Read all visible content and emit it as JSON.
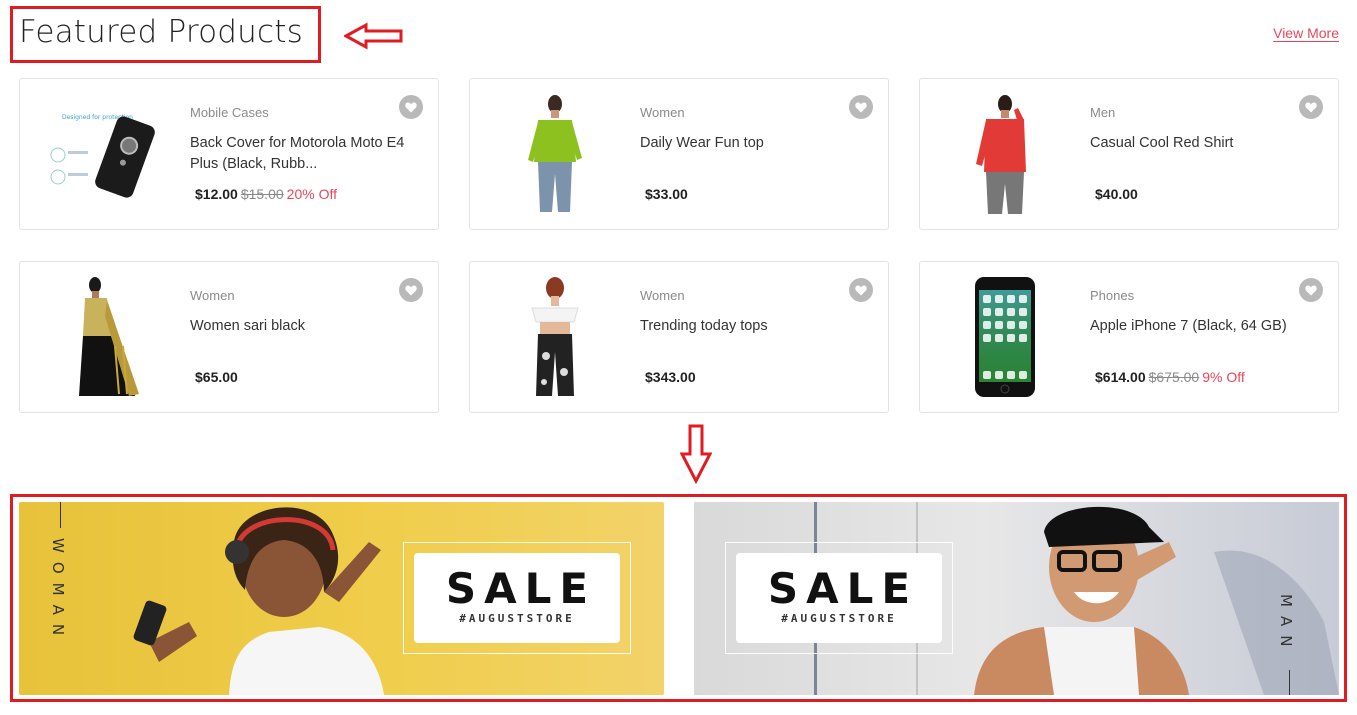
{
  "header": {
    "title": "Featured Products",
    "view_more": "View More"
  },
  "products": [
    {
      "category": "Mobile Cases",
      "name": "Back Cover for Motorola Moto E4 Plus (Black, Rubb...",
      "price": "$12.00",
      "old_price": "$15.00",
      "discount": "20% Off",
      "image": "phone-case-image"
    },
    {
      "category": "Women",
      "name": "Daily Wear Fun top",
      "price": "$33.00",
      "old_price": "",
      "discount": "",
      "image": "green-top-image"
    },
    {
      "category": "Men",
      "name": "Casual Cool Red Shirt",
      "price": "$40.00",
      "old_price": "",
      "discount": "",
      "image": "red-shirt-image"
    },
    {
      "category": "Women",
      "name": "Women sari black",
      "price": "$65.00",
      "old_price": "",
      "discount": "",
      "image": "sari-image"
    },
    {
      "category": "Women",
      "name": "Trending today tops",
      "price": "$343.00",
      "old_price": "",
      "discount": "",
      "image": "white-top-image"
    },
    {
      "category": "Phones",
      "name": "Apple iPhone 7 (Black, 64 GB)",
      "price": "$614.00",
      "old_price": "$675.00",
      "discount": "9% Off",
      "image": "iphone-image"
    }
  ],
  "banners": [
    {
      "label": "WOMAN",
      "sale": "SALE",
      "tag": "#AUGUSTSTORE",
      "background": "#efc944"
    },
    {
      "label": "MAN",
      "sale": "SALE",
      "tag": "#AUGUSTSTORE",
      "background": "#dcdcdc"
    }
  ],
  "colors": {
    "accent": "#e8465a",
    "annotation": "#e11b22"
  }
}
